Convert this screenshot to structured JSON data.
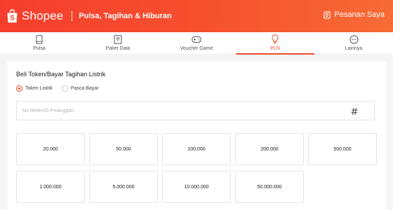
{
  "header": {
    "brand": "Shopee",
    "subtitle": "Pulsa, Tagihan & Hiburan",
    "orders_label": "Pesanan Saya",
    "brand_color": "#ee4d2d"
  },
  "tabs": [
    {
      "label": "Pulsa",
      "icon": "phone-icon",
      "active": false
    },
    {
      "label": "Paket Data",
      "icon": "signal-icon",
      "active": false
    },
    {
      "label": "Voucher Game",
      "icon": "gamepad-icon",
      "active": false
    },
    {
      "label": "PLN",
      "icon": "lightbulb-icon",
      "active": true
    },
    {
      "label": "Lainnya",
      "icon": "more-icon",
      "active": false
    }
  ],
  "form": {
    "title": "Beli Token/Bayar Tagihan Listrik",
    "options": [
      {
        "label": "Token Listrik",
        "checked": true
      },
      {
        "label": "Pasca Bayar",
        "checked": false
      }
    ],
    "input": {
      "placeholder": "No Meter/ID Pelanggan",
      "value": ""
    },
    "nominals": [
      "20.000",
      "50.000",
      "100.000",
      "200.000",
      "500.000",
      "1.000.000",
      "5.000.000",
      "10.000.000",
      "50.000.000"
    ]
  }
}
